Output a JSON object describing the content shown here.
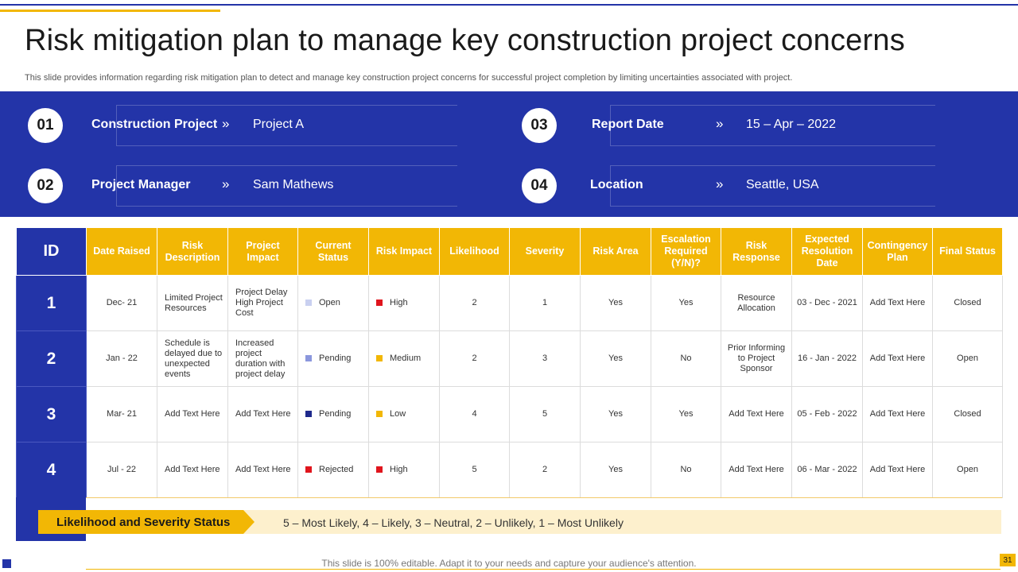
{
  "slide": {
    "title": "Risk mitigation plan to manage key construction project concerns",
    "subtitle": "This slide provides information regarding risk mitigation plan to detect and manage key construction project concerns for successful project completion by limiting uncertainties associated with project."
  },
  "info": {
    "items": [
      {
        "num": "01",
        "label": "Construction Project",
        "chevron": "»",
        "value": "Project A"
      },
      {
        "num": "02",
        "label": "Project Manager",
        "chevron": "»",
        "value": "Sam Mathews"
      },
      {
        "num": "03",
        "label": "Report Date",
        "chevron": "»",
        "value": "15 – Apr – 2022"
      },
      {
        "num": "04",
        "label": "Location",
        "chevron": "»",
        "value": "Seattle, USA"
      }
    ]
  },
  "table": {
    "headers": [
      "ID",
      "Date Raised",
      "Risk Description",
      "Project Impact",
      "Current Status",
      "Risk Impact",
      "Likelihood",
      "Severity",
      "Risk Area",
      "Escalation Required (Y/N)?",
      "Risk Response",
      "Expected Resolution Date",
      "Contingency Plan",
      "Final Status"
    ],
    "rows": [
      {
        "id": "1",
        "date": "Dec- 21",
        "description": "Limited Project Resources",
        "impact": "Project Delay High Project Cost",
        "status": "Open",
        "status_color": "#c9d0f0",
        "risk_impact": "High",
        "risk_color": "#e0151d",
        "likelihood": "2",
        "severity": "1",
        "area": "Yes",
        "escalation": "Yes",
        "response": "Resource Allocation",
        "resolution": "03 - Dec - 2021",
        "contingency": "Add Text Here",
        "final": "Closed"
      },
      {
        "id": "2",
        "date": "Jan - 22",
        "description": "Schedule is delayed due to unexpected events",
        "impact": "Increased project duration with project delay",
        "status": "Pending",
        "status_color": "#8b97dd",
        "risk_impact": "Medium",
        "risk_color": "#f2b705",
        "likelihood": "2",
        "severity": "3",
        "area": "Yes",
        "escalation": "No",
        "response": "Prior Informing to Project Sponsor",
        "resolution": "16 - Jan - 2022",
        "contingency": "Add Text Here",
        "final": "Open"
      },
      {
        "id": "3",
        "date": "Mar- 21",
        "description": "Add Text Here",
        "impact": "Add Text Here",
        "status": "Pending",
        "status_color": "#1e2a8c",
        "risk_impact": "Low",
        "risk_color": "#f2b705",
        "likelihood": "4",
        "severity": "5",
        "area": "Yes",
        "escalation": "Yes",
        "response": "Add Text Here",
        "resolution": "05 - Feb - 2022",
        "contingency": "Add Text Here",
        "final": "Closed"
      },
      {
        "id": "4",
        "date": "Jul - 22",
        "description": "Add Text Here",
        "impact": "Add Text Here",
        "status": "Rejected",
        "status_color": "#e0151d",
        "risk_impact": "High",
        "risk_color": "#e0151d",
        "likelihood": "5",
        "severity": "2",
        "area": "Yes",
        "escalation": "No",
        "response": "Add Text Here",
        "resolution": "06 - Mar - 2022",
        "contingency": "Add Text Here",
        "final": "Open"
      }
    ]
  },
  "legend": {
    "label": "Likelihood and Severity Status",
    "text": "5 – Most Likely, 4 – Likely, 3 – Neutral, 2 – Unlikely, 1 – Most Unlikely"
  },
  "footer": {
    "text": "This slide is 100% editable. Adapt it to your needs and capture your audience's attention.",
    "page_number": "31"
  },
  "colors": {
    "primary_blue": "#2334a8",
    "accent_gold": "#f2b705",
    "legend_bg": "#fdf0cd"
  }
}
